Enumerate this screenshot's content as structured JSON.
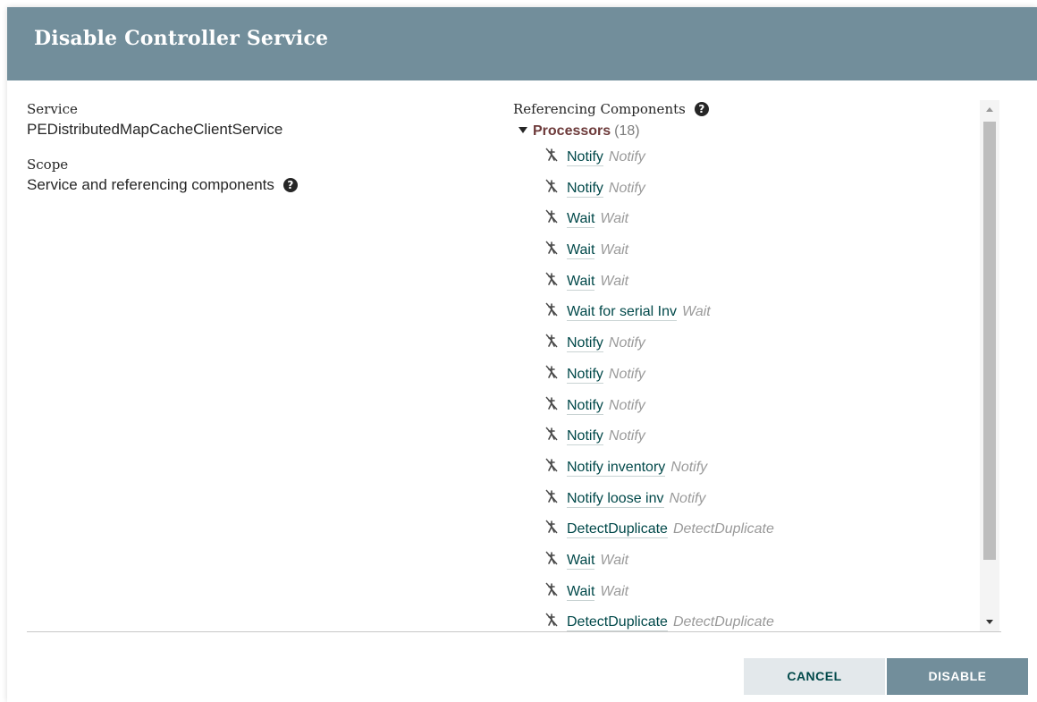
{
  "dialog": {
    "title": "Disable Controller Service"
  },
  "service": {
    "label": "Service",
    "value": "PEDistributedMapCacheClientService"
  },
  "scope": {
    "label": "Scope",
    "value": "Service and referencing components"
  },
  "referencing": {
    "label": "Referencing Components",
    "group_name": "Processors",
    "group_count": "(18)",
    "processors": [
      {
        "name": "Notify",
        "type": "Notify"
      },
      {
        "name": "Notify",
        "type": "Notify"
      },
      {
        "name": "Wait",
        "type": "Wait"
      },
      {
        "name": "Wait",
        "type": "Wait"
      },
      {
        "name": "Wait",
        "type": "Wait"
      },
      {
        "name": "Wait for serial Inv",
        "type": "Wait"
      },
      {
        "name": "Notify",
        "type": "Notify"
      },
      {
        "name": "Notify",
        "type": "Notify"
      },
      {
        "name": "Notify",
        "type": "Notify"
      },
      {
        "name": "Notify",
        "type": "Notify"
      },
      {
        "name": "Notify inventory",
        "type": "Notify"
      },
      {
        "name": "Notify loose inv",
        "type": "Notify"
      },
      {
        "name": "DetectDuplicate",
        "type": "DetectDuplicate"
      },
      {
        "name": "Wait",
        "type": "Wait"
      },
      {
        "name": "Wait",
        "type": "Wait"
      },
      {
        "name": "DetectDuplicate",
        "type": "DetectDuplicate"
      }
    ]
  },
  "buttons": {
    "cancel": "CANCEL",
    "disable": "DISABLE"
  },
  "colors": {
    "header_bg": "#728e9b",
    "link": "#004849",
    "group_name": "#6d3a3a"
  },
  "icons": {
    "help": "question-circle-icon",
    "processor": "processor-stopped-icon",
    "expand": "caret-down-icon"
  }
}
